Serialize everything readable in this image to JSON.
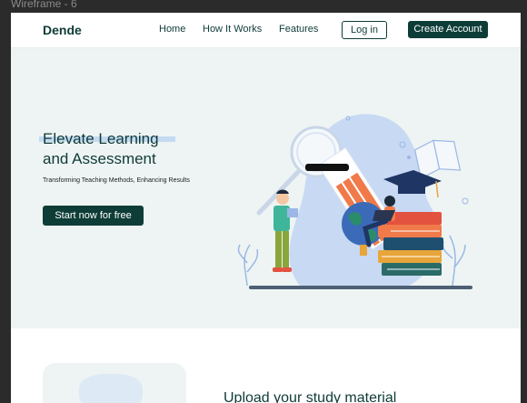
{
  "canvas": {
    "label": "Wireframe - 6"
  },
  "nav": {
    "brand": "Dende",
    "links": [
      "Home",
      "How It Works",
      "Features"
    ],
    "login_label": "Log in",
    "create_label": "Create Account"
  },
  "hero": {
    "title_line1": "Elevate Learning",
    "title_line2": "and Assessment",
    "subtitle": "Transforming Teaching Methods, Enhancing Results",
    "cta_label": "Start now for free"
  },
  "section2": {
    "title": "Upload your study material"
  },
  "colors": {
    "primary": "#0e3d38",
    "hero_bg": "#eef4f3",
    "accent_blue": "#b8d3f0",
    "illustration_blue": "#c7d9f3",
    "illustration_orange": "#f07a4a"
  }
}
